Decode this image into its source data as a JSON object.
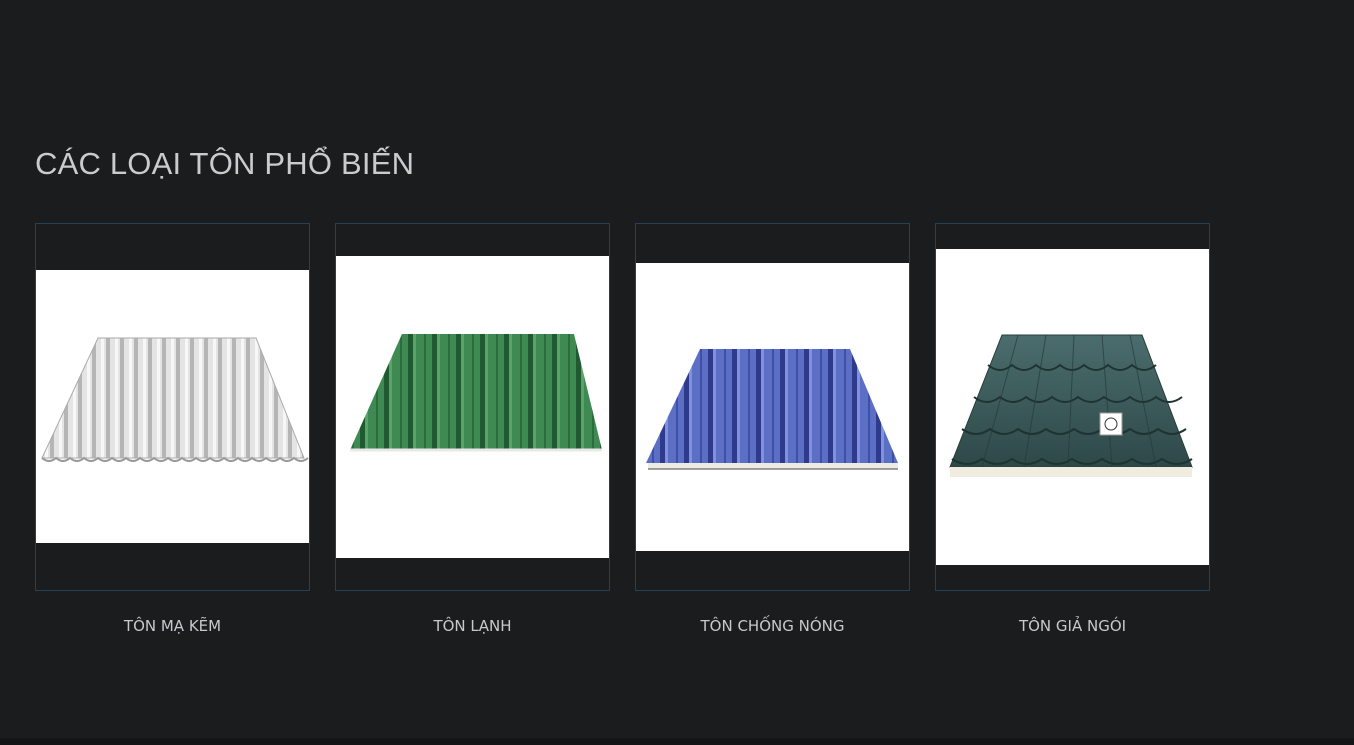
{
  "section": {
    "title": "CÁC LOẠI TÔN PHỔ BIẾN"
  },
  "products": [
    {
      "name": "TÔN MẠ KẼM",
      "image_icon": "galvanized-sheet-icon",
      "color": "#d8d8d8"
    },
    {
      "name": "TÔN LẠNH",
      "image_icon": "green-cold-sheet-icon",
      "color": "#2f7a43"
    },
    {
      "name": "TÔN CHỐNG NÓNG",
      "image_icon": "blue-insulated-sheet-icon",
      "color": "#4656a6"
    },
    {
      "name": "TÔN GIẢ NGÓI",
      "image_icon": "tile-sheet-icon",
      "color": "#3a5a5a"
    }
  ]
}
